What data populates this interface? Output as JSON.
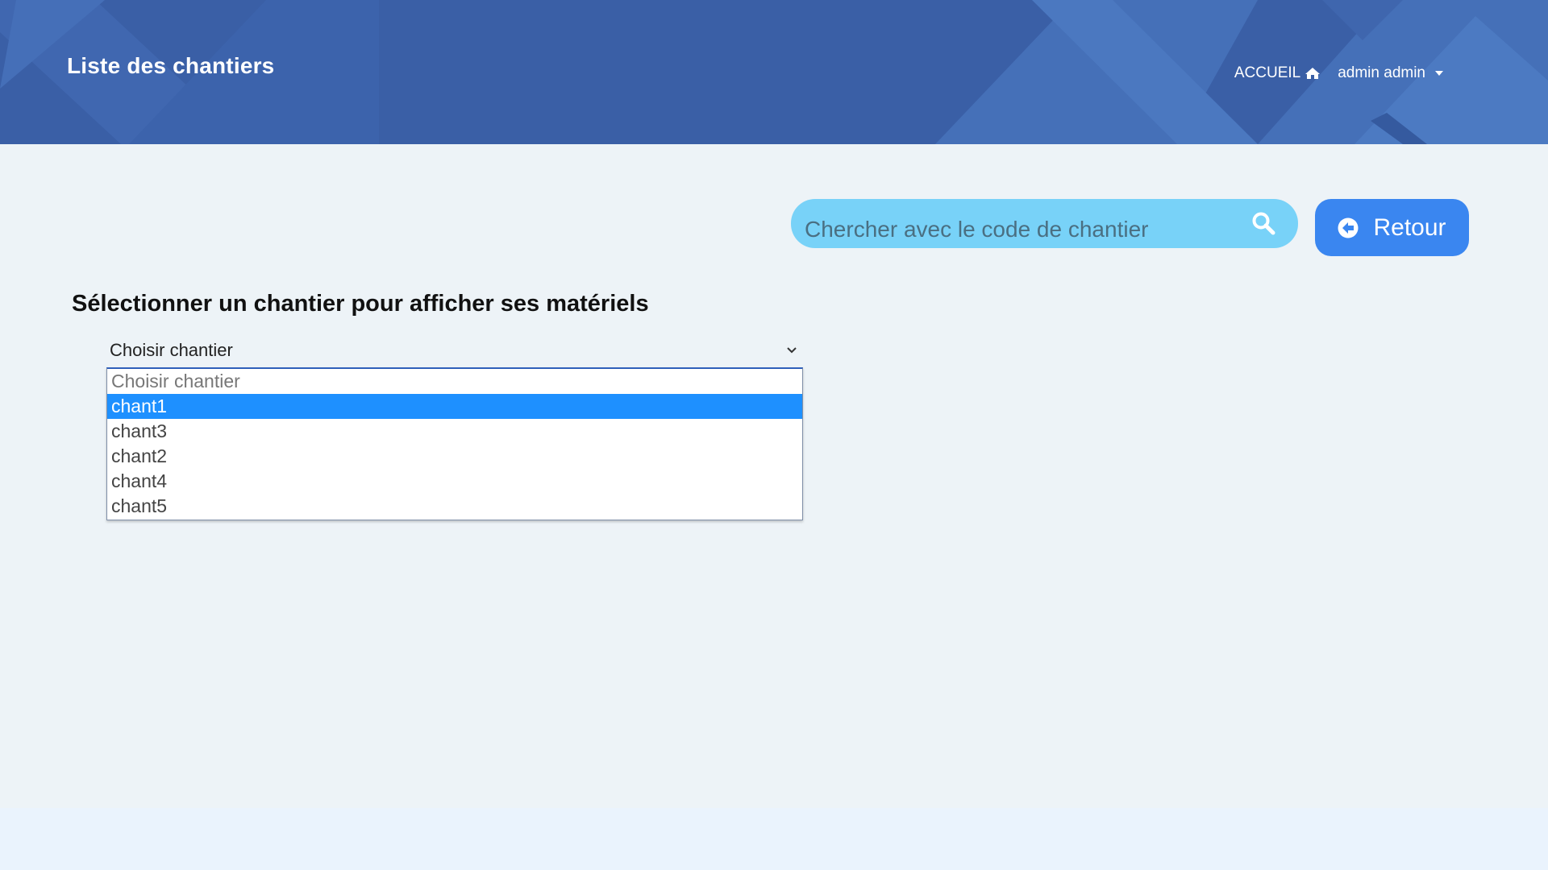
{
  "header": {
    "title": "Liste des chantiers",
    "background_color": "#3a5fa6",
    "nav": {
      "home_label": "ACCUEIL",
      "home_icon": "home-icon",
      "user_label": "admin admin",
      "user_icon": "caret-down-icon"
    }
  },
  "toolbar": {
    "search_placeholder": "Chercher avec le code de chantier",
    "search_value": "",
    "search_icon": "search-icon",
    "back_label": "Retour",
    "back_icon": "arrow-circle-left-icon"
  },
  "main": {
    "section_title": "Sélectionner un chantier pour afficher ses matériels",
    "select": {
      "value": "Choisir chantier",
      "options": [
        "Choisir chantier",
        "chant1",
        "chant3",
        "chant2",
        "chant4",
        "chant5"
      ],
      "highlighted": "chant1"
    }
  },
  "colors": {
    "accent": "#3a86f0",
    "search_bg": "#78d2f8",
    "highlight": "#1e90ff",
    "page_bg": "#edf3f7"
  }
}
